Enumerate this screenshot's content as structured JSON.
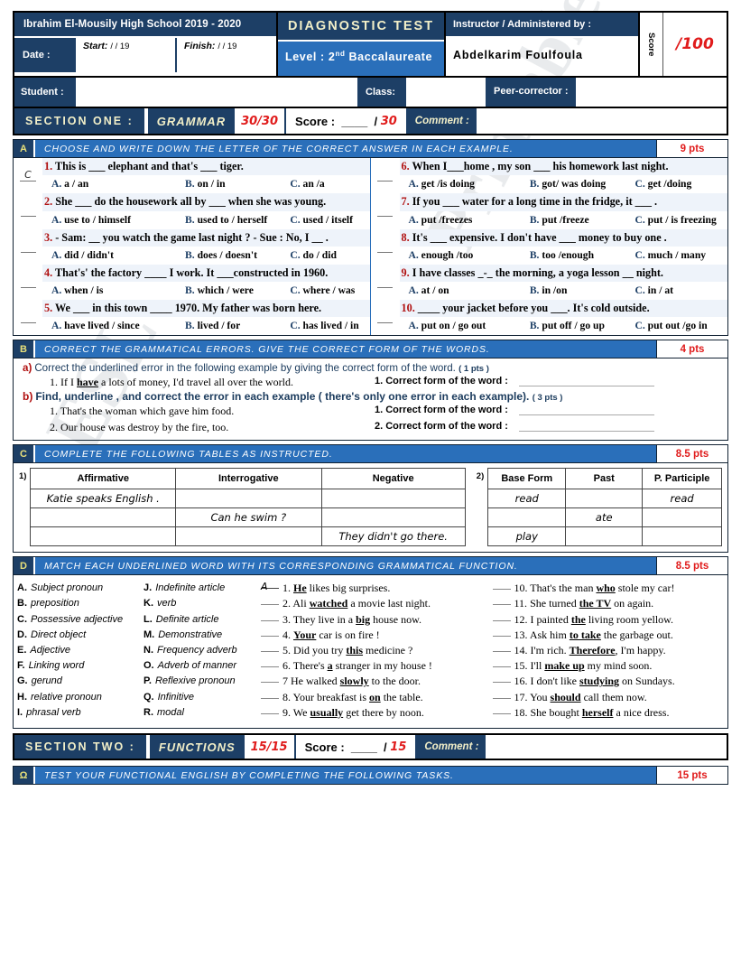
{
  "header": {
    "school": "Ibrahim El-Mousily High School  2019 - 2020",
    "date_label": "Date :",
    "start_label": "Start:",
    "start_value": "/   /  19",
    "finish_label": "Finish:",
    "finish_value": "/   / 19",
    "test_title": "DIAGNOSTIC TEST",
    "level_label": "Level :",
    "level_value_main": "2",
    "level_value_sup": "nd",
    "level_value_rest": "Baccalaureate",
    "instructor_label": "Instructor / Administered by :",
    "instructor_name": "Abdelkarim Foulfoula",
    "score_label": "Score",
    "score_value": "/100"
  },
  "student_row": {
    "student_label": "Student :",
    "class_label": "Class:",
    "peer_label": "Peer-corrector :"
  },
  "section_one": {
    "section_label": "SECTION ONE :",
    "subject": "GRAMMAR",
    "total": "30/30",
    "score_prefix": "Score :  ____  / ",
    "score_max": "30",
    "comment_label": "Comment :"
  },
  "exercise_a": {
    "badge": "A",
    "instruction": "CHOOSE AND WRITE DOWN THE LETTER OF THE CORRECT ANSWER IN EACH EXAMPLE.",
    "points": "9 pts",
    "questions_left": [
      {
        "answer": "C",
        "number": "1.",
        "text": "This is ___  elephant and that's ___ tiger.",
        "options": [
          "A.  a / an",
          "B.  on / in",
          "C.  an /a"
        ]
      },
      {
        "answer": "",
        "number": "2.",
        "text": "She ___ do the housework all by ___ when she was young.",
        "options": [
          "A.  use to / himself",
          "B. used to / herself",
          "C.  used / itself"
        ]
      },
      {
        "answer": "",
        "number": "3.",
        "text": "- Sam: __ you watch the game last night ? - Sue : No, I __ .",
        "options": [
          "A.  did / didn't",
          "B.  does / doesn't",
          "C.  do / did"
        ]
      },
      {
        "answer": "",
        "number": "4.",
        "text": "That's' the factory ____ I work. It ___constructed in 1960.",
        "options": [
          "A.  when / is",
          "B.  which / were",
          "C.  where / was"
        ]
      },
      {
        "answer": "",
        "number": "5.",
        "text": "We ___ in this town ____ 1970. My father was born here.",
        "options": [
          "A.  have lived / since",
          "B.  lived / for",
          "C.  has lived / in"
        ]
      }
    ],
    "questions_right": [
      {
        "answer": "",
        "number": "6.",
        "text": "When I___home , my son ___ his homework last night.",
        "options": [
          "A.  get /is doing",
          "B.  got/ was doing",
          "C.  get /doing"
        ]
      },
      {
        "answer": "",
        "number": "7.",
        "text": "If you ___ water for a long time in the fridge, it ___ .",
        "options": [
          "A.  put /freezes",
          "B.  put /freeze",
          "C.  put / is freezing"
        ]
      },
      {
        "answer": "",
        "number": "8.",
        "text": "It's ___ expensive. I don't have ___ money to buy one .",
        "options": [
          "A.  enough /too",
          "B.  too /enough",
          "C.  much / many"
        ]
      },
      {
        "answer": "",
        "number": "9.",
        "text": "I have classes _-_ the morning, a yoga lesson __ night.",
        "options": [
          "A.  at / on",
          "B.  in /on",
          "C.  in / at"
        ]
      },
      {
        "answer": "",
        "number": "10.",
        "text": "____ your jacket  before you ___. It's cold outside.",
        "options": [
          "A.  put on / go out",
          "B.  put off / go up",
          "C.  put out /go in"
        ]
      }
    ]
  },
  "exercise_b": {
    "badge": "B",
    "instruction": "CORRECT THE GRAMMATICAL ERRORS. GIVE THE CORRECT FORM OF THE WORDS.",
    "points": "4 pts",
    "part_a_tag": "a)",
    "part_a_text": "Correct the underlined error in the following example by giving the  correct form of the word.",
    "part_a_pts": "( 1 pts )",
    "part_a_items": [
      {
        "sentence_pre": "1. If  I  ",
        "sentence_underline": "have",
        "sentence_post": "  a lots of money, I'd travel all over the world.",
        "answer_label": "1. Correct form of the word :"
      }
    ],
    "part_b_tag": "b)",
    "part_b_text": "Find, underline , and correct the error in each example ( there's only one error in each example).",
    "part_b_pts": "( 3 pts )",
    "part_b_items": [
      {
        "sentence": "1. That's the woman which gave him food.",
        "answer_label": "1. Correct form of the word :"
      },
      {
        "sentence": "2. Our house was destroy by the fire, too.",
        "answer_label": "2. Correct form of the word :"
      }
    ]
  },
  "exercise_c": {
    "badge": "C",
    "instruction": "COMPLETE THE FOLLOWING TABLES AS INSTRUCTED.",
    "points": "8.5 pts",
    "table1": {
      "number": "1)",
      "headers": [
        "Affirmative",
        "Interrogative",
        "Negative"
      ],
      "rows": [
        [
          "Katie speaks English .",
          "",
          ""
        ],
        [
          "",
          "Can he swim ?",
          ""
        ],
        [
          "",
          "",
          "They didn't go there."
        ]
      ]
    },
    "table2": {
      "number": "2)",
      "headers": [
        "Base Form",
        "Past",
        "P. Participle"
      ],
      "rows": [
        [
          "read",
          "",
          "read"
        ],
        [
          "",
          "ate",
          ""
        ],
        [
          "play",
          "",
          ""
        ]
      ]
    }
  },
  "exercise_d": {
    "badge": "D",
    "instruction": "MATCH EACH UNDERLINED WORD WITH ITS CORRESPONDING GRAMMATICAL FUNCTION.",
    "points": "8.5 pts",
    "bank_col1": [
      {
        "letter": "A.",
        "label": "Subject pronoun"
      },
      {
        "letter": "B.",
        "label": "preposition"
      },
      {
        "letter": "C.",
        "label": "Possessive adjective"
      },
      {
        "letter": "D.",
        "label": "Direct object"
      },
      {
        "letter": "E.",
        "label": "Adjective"
      },
      {
        "letter": "F.",
        "label": "Linking word"
      },
      {
        "letter": "G.",
        "label": "gerund"
      },
      {
        "letter": "H.",
        "label": "relative pronoun"
      },
      {
        "letter": "I.",
        "label": "phrasal verb"
      }
    ],
    "bank_col2": [
      {
        "letter": "J.",
        "label": "Indefinite article"
      },
      {
        "letter": "K.",
        "label": "verb"
      },
      {
        "letter": "L.",
        "label": "Definite article"
      },
      {
        "letter": "M.",
        "label": "Demonstrative"
      },
      {
        "letter": "N.",
        "label": "Frequency adverb"
      },
      {
        "letter": "O.",
        "label": "Adverb of manner"
      },
      {
        "letter": "P.",
        "label": "Reflexive pronoun"
      },
      {
        "letter": "Q.",
        "label": "Infinitive"
      },
      {
        "letter": "R.",
        "label": "modal"
      }
    ],
    "sentences_left": [
      {
        "answer": "A",
        "number": "1.",
        "pre": "",
        "word": "He",
        "post": " likes big surprises."
      },
      {
        "answer": "",
        "number": "2.",
        "pre": "Ali ",
        "word": "watched",
        "post": " a movie last night."
      },
      {
        "answer": "",
        "number": "3.",
        "pre": "They live in a ",
        "word": "big",
        "post": " house now."
      },
      {
        "answer": "",
        "number": "4.",
        "pre": "",
        "word": "Your",
        "post": " car is on fire !"
      },
      {
        "answer": "",
        "number": "5.",
        "pre": "Did you try ",
        "word": "this",
        "post": " medicine ?"
      },
      {
        "answer": "",
        "number": "6.",
        "pre": "There's ",
        "word": "a",
        "post": " stranger in my house !"
      },
      {
        "answer": "",
        "number": "7",
        "pre": "He walked ",
        "word": "slowly",
        "post": " to the door."
      },
      {
        "answer": "",
        "number": "8.",
        "pre": "Your breakfast is ",
        "word": "on",
        "post": " the table."
      },
      {
        "answer": "",
        "number": "9.",
        "pre": "We ",
        "word": "usually",
        "post": " get there by noon."
      }
    ],
    "sentences_right": [
      {
        "answer": "",
        "number": "10.",
        "pre": "That's the man ",
        "word": "who",
        "post": " stole my car!"
      },
      {
        "answer": "",
        "number": "11.",
        "pre": "She turned ",
        "word": "the TV",
        "post": " on again."
      },
      {
        "answer": "",
        "number": "12.",
        "pre": "I painted ",
        "word": "the",
        "post": " living room yellow."
      },
      {
        "answer": "",
        "number": "13.",
        "pre": "Ask him ",
        "word": "to take",
        "post": " the garbage out."
      },
      {
        "answer": "",
        "number": "14.",
        "pre": "I'm rich. ",
        "word": "Therefore",
        "post": ", I'm happy."
      },
      {
        "answer": "",
        "number": "15.",
        "pre": "I'll ",
        "word": "make up",
        "post": " my mind soon."
      },
      {
        "answer": "",
        "number": "16.",
        "pre": "I don't like ",
        "word": "studying",
        "post": " on Sundays."
      },
      {
        "answer": "",
        "number": "17.",
        "pre": "You ",
        "word": "should",
        "post": " call them now."
      },
      {
        "answer": "",
        "number": "18.",
        "pre": "She bought ",
        "word": "herself",
        "post": " a nice dress."
      }
    ]
  },
  "section_two": {
    "section_label": "SECTION TWO :",
    "subject": "FUNCTIONS",
    "total": "15/15",
    "score_prefix": "Score :  ____  / ",
    "score_max": "15",
    "comment_label": "Comment :"
  },
  "exercise_omega": {
    "badge": "Ω",
    "instruction": "TEST YOUR FUNCTIONAL ENGLISH BY COMPLETING THE FOLLOWING TASKS.",
    "points": "15 pts"
  },
  "watermark": {
    "line1": "Printablets.com",
    "line2": "ESL"
  }
}
